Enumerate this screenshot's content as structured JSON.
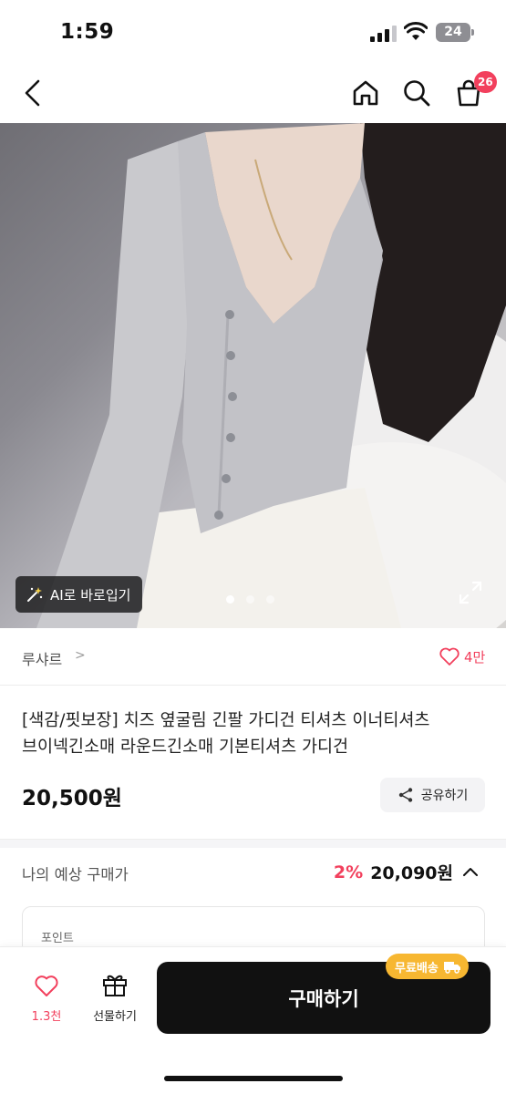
{
  "status_bar": {
    "time": "1:59",
    "battery": "24"
  },
  "nav": {
    "cart_count": "26"
  },
  "hero": {
    "ai_button_label": "AI로 바로입기",
    "page_count": 3,
    "active_page": 1
  },
  "store": {
    "name": "루샤르",
    "chevron": ">",
    "like_count": "4만"
  },
  "product": {
    "title": "[색감/핏보장] 치즈 옆굴림 긴팔 가디건 티셔츠 이너티셔츠 브이넥긴소매 라운드긴소매 기본티셔츠 가디건",
    "price": "20,500원",
    "share_label": "공유하기"
  },
  "expected": {
    "label": "나의 예상 구매가",
    "discount": "2%",
    "price": "20,090원",
    "points_label": "포인트"
  },
  "bottom": {
    "wish_count": "1.3천",
    "gift_label": "선물하기",
    "buy_label": "구매하기",
    "free_shipping": "무료배송"
  },
  "colors": {
    "accent": "#f2405d",
    "buy_button": "#111111",
    "shipping_badge": "#f7b731"
  }
}
